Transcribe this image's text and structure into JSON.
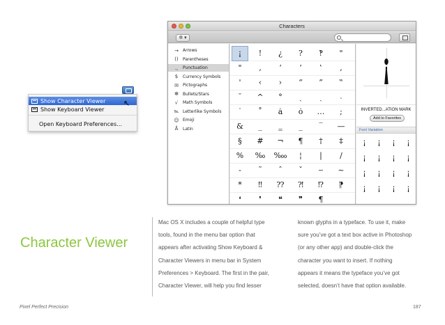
{
  "input_menu": {
    "items": [
      {
        "label": "Show Character Viewer",
        "selected": true
      },
      {
        "label": "Show Keyboard Viewer",
        "selected": false
      },
      {
        "label": "Open Keyboard Preferences…",
        "selected": false
      }
    ]
  },
  "characters_window": {
    "title": "Characters",
    "gear_label": "✲ ▾",
    "categories": [
      {
        "icon": "→",
        "label": "Arrows",
        "selected": false
      },
      {
        "icon": "()",
        "label": "Parentheses",
        "selected": false
      },
      {
        "icon": ".,",
        "label": "Punctuation",
        "selected": true
      },
      {
        "icon": "$",
        "label": "Currency Symbols",
        "selected": false
      },
      {
        "icon": "✉",
        "label": "Pictographs",
        "selected": false
      },
      {
        "icon": "✻",
        "label": "Bullets/Stars",
        "selected": false
      },
      {
        "icon": "√",
        "label": "Math Symbols",
        "selected": false
      },
      {
        "icon": "℡",
        "label": "Letterlike Symbols",
        "selected": false
      },
      {
        "icon": "☺",
        "label": "Emoji",
        "selected": false
      },
      {
        "icon": "Å",
        "label": "Latin",
        "selected": false
      }
    ],
    "glyph_rows": [
      [
        "¡",
        "!",
        "¿",
        "?",
        "‽",
        "\""
      ],
      [
        "\"",
        "‚",
        "‘",
        "’",
        "‛",
        ","
      ],
      [
        "'",
        "‹",
        "›",
        "“",
        "”",
        "‟"
      ],
      [
        "˘",
        "^",
        "°",
        "ˎ",
        "ˏ",
        "˴"
      ],
      [
        "˙",
        "˚",
        "ȧ",
        "ȯ",
        "…",
        ";"
      ],
      [
        "&",
        "_",
        "‗",
        "_",
        "‾",
        "—"
      ],
      [
        "§",
        "#",
        "¬",
        "¶",
        "†",
        "‡"
      ],
      [
        "%",
        "‰",
        "‱",
        "¦",
        "|",
        "/"
      ],
      [
        "‐",
        "˜",
        "ˆ",
        "ˇ",
        "‒",
        "~"
      ],
      [
        "*",
        "‼",
        "⁇",
        "⁈",
        "⁉",
        "⁋"
      ],
      [
        "❛",
        "❜",
        "❝",
        "❞",
        "¶",
        ""
      ]
    ],
    "selected_glyph": "¡",
    "preview_glyph": "¡",
    "character_name": "INVERTED...ATION MARK",
    "add_favorites_label": "Add to Favorites",
    "font_variation_label": "Font Variation",
    "font_variations": [
      "¡",
      "¡",
      "¡",
      "¡",
      "¡",
      "¡",
      "¡",
      "¡",
      "¡",
      "¡",
      "¡",
      "¡",
      "¡",
      "¡",
      "¡",
      "¡"
    ]
  },
  "article": {
    "heading": "Character Viewer",
    "col1_lines": [
      "Mac OS X includes a couple of helpful type",
      "tools, found in the menu bar option that",
      "appears after activating Show Keyboard &",
      "Character Viewers in menu bar in System",
      "Preferences > Keyboard. The first in the pair,",
      "Character Viewer, will help you find lesser"
    ],
    "col2_lines": [
      "known glyphs in a typeface. To use it, make",
      "sure you’ve got a text box active in Photoshop",
      "(or any other app) and double-click the",
      "character you want to insert. If nothing",
      "appears it means the typeface you’ve got",
      "selected, doesn’t have that option available."
    ]
  },
  "footer": {
    "left": "Pixel Perfect Precision",
    "page_number": "187"
  }
}
